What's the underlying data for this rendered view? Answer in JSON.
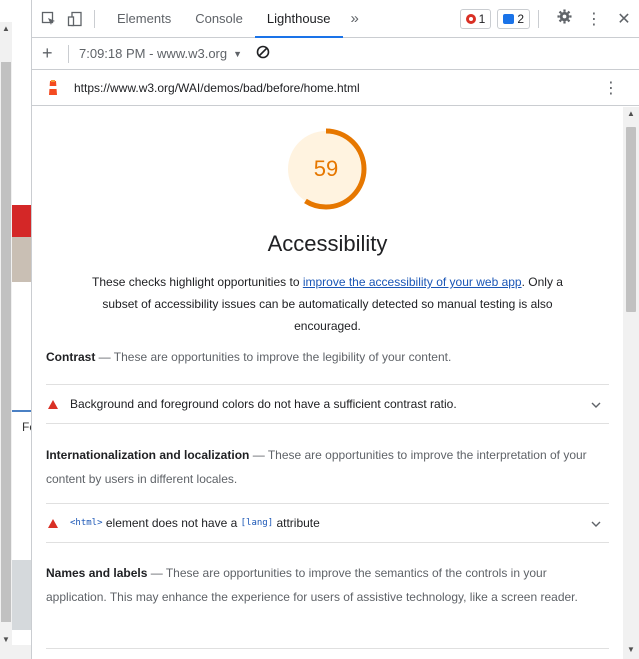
{
  "toolbar": {
    "tabs": [
      "Elements",
      "Console",
      "Lighthouse"
    ],
    "active_tab": "Lighthouse",
    "more": "»",
    "errors_count": "1",
    "messages_count": "2"
  },
  "report_bar": {
    "report_label": "7:09:18 PM - www.w3.org",
    "dropdown_arrow": "▼"
  },
  "url_bar": {
    "url": "https://www.w3.org/WAI/demos/bad/before/home.html"
  },
  "category": {
    "score": "59",
    "score_fraction": 0.59,
    "title": "Accessibility",
    "desc_before": "These checks highlight opportunities to ",
    "desc_link": "improve the accessibility of your web app",
    "desc_after": ". Only a subset of accessibility issues can be automatically detected so manual testing is also encouraged."
  },
  "groups": [
    {
      "title": "Contrast",
      "description": "These are opportunities to improve the legibility of your content."
    },
    {
      "title": "Internationalization and localization",
      "description": "These are opportunities to improve the interpretation of your content by users in different locales."
    },
    {
      "title": "Names and labels",
      "description": "These are opportunities to improve the semantics of the controls in your application. This may enhance the experience for users of assistive technology, like a screen reader."
    }
  ],
  "audits": {
    "contrast": "Background and foreground colors do not have a sufficient contrast ratio.",
    "lang_code1": "<html>",
    "lang_text1": " element does not have a ",
    "lang_code2": "[lang]",
    "lang_text2": " attribute"
  },
  "left_page": {
    "fragment": "Fe"
  },
  "colors": {
    "accent": "#1a73e8",
    "score_average": "#e67700",
    "fail": "#d93025"
  }
}
